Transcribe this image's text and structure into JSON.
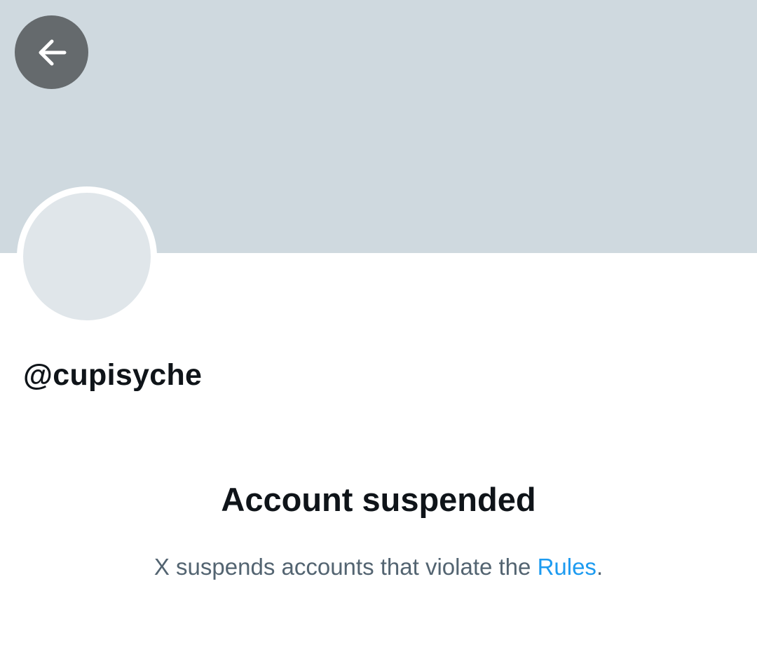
{
  "colors": {
    "banner": "#cfd9df",
    "back_button_bg": "#656a6d",
    "back_icon": "#ffffff",
    "avatar": "#e0e6ea",
    "primary_text": "#0f1419",
    "secondary_text": "#536471",
    "link": "#1d9bf0"
  },
  "header": {
    "back_icon": "arrow-left-icon"
  },
  "profile": {
    "handle": "@cupisyche"
  },
  "notice": {
    "title": "Account suspended",
    "description_prefix": "X suspends accounts that violate the",
    "link_text": "Rules",
    "description_suffix": "."
  }
}
